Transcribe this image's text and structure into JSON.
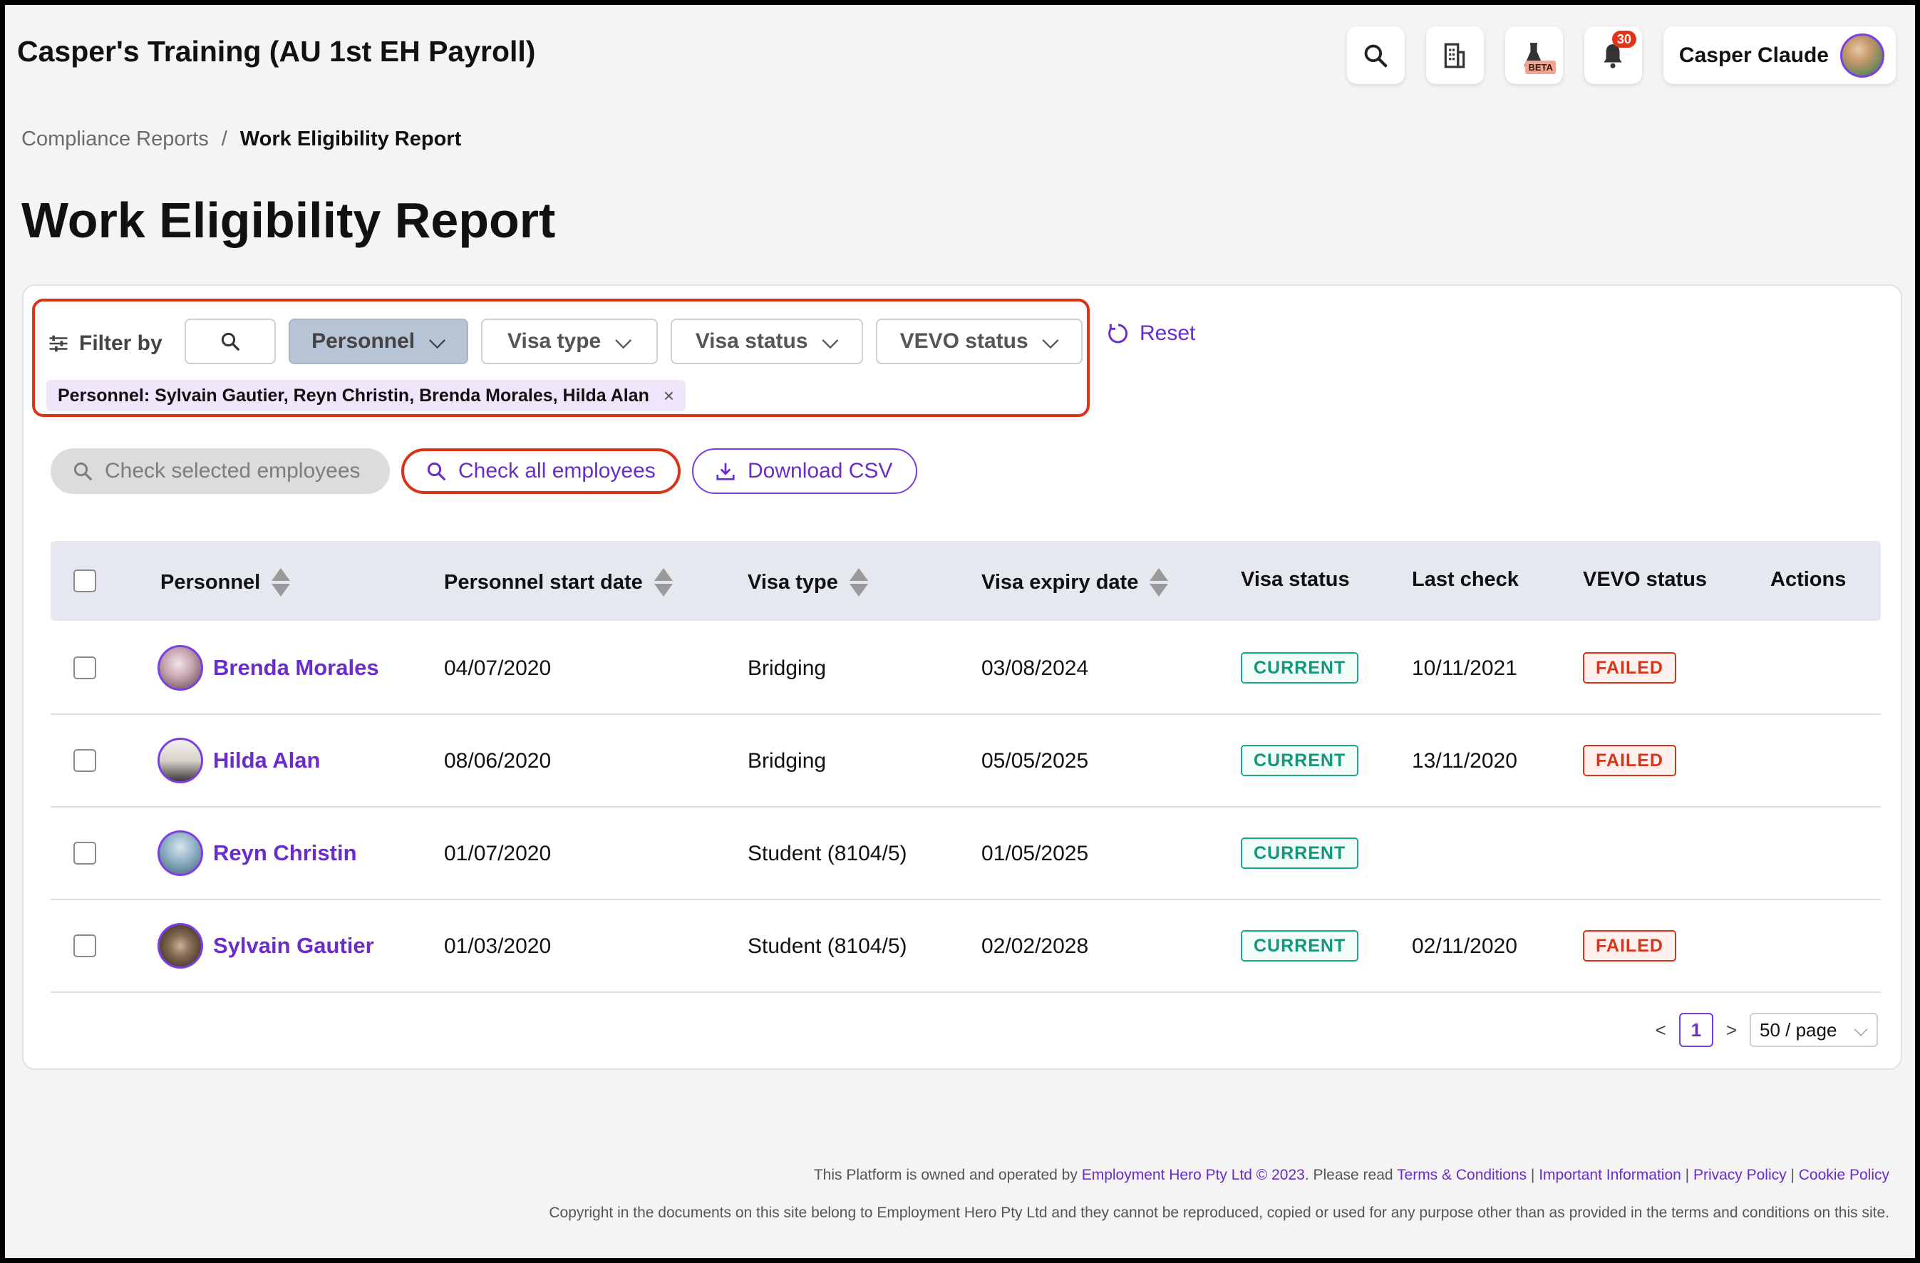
{
  "header": {
    "app_title": "Casper's Training (AU 1st EH Payroll)",
    "user_name": "Casper Claude",
    "notification_count": "30",
    "beta_label": "BETA"
  },
  "breadcrumb": {
    "parent": "Compliance Reports",
    "separator": "/",
    "current": "Work Eligibility Report"
  },
  "page_title": "Work Eligibility Report",
  "filters": {
    "label": "Filter by",
    "buttons": [
      "Personnel",
      "Visa type",
      "Visa status",
      "VEVO status"
    ],
    "active_tag": "Personnel: Sylvain Gautier, Reyn Christin, Brenda Morales, Hilda Alan",
    "reset_label": "Reset"
  },
  "actions": {
    "check_selected": "Check selected employees",
    "check_all": "Check all employees",
    "download_csv": "Download CSV"
  },
  "table": {
    "columns": [
      "Personnel",
      "Personnel start date",
      "Visa type",
      "Visa expiry date",
      "Visa status",
      "Last check",
      "VEVO status",
      "Actions"
    ],
    "rows": [
      {
        "name": "Brenda Morales",
        "start": "04/07/2020",
        "visa_type": "Bridging",
        "expiry": "03/08/2024",
        "visa_status": "CURRENT",
        "last_check": "10/11/2021",
        "vevo": "FAILED"
      },
      {
        "name": "Hilda Alan",
        "start": "08/06/2020",
        "visa_type": "Bridging",
        "expiry": "05/05/2025",
        "visa_status": "CURRENT",
        "last_check": "13/11/2020",
        "vevo": "FAILED"
      },
      {
        "name": "Reyn Christin",
        "start": "01/07/2020",
        "visa_type": "Student (8104/5)",
        "expiry": "01/05/2025",
        "visa_status": "CURRENT",
        "last_check": "",
        "vevo": ""
      },
      {
        "name": "Sylvain Gautier",
        "start": "01/03/2020",
        "visa_type": "Student (8104/5)",
        "expiry": "02/02/2028",
        "visa_status": "CURRENT",
        "last_check": "02/11/2020",
        "vevo": "FAILED"
      }
    ]
  },
  "pagination": {
    "prev": "<",
    "current_page": "1",
    "next": ">",
    "page_size": "50 / page"
  },
  "footer": {
    "line1_prefix": "This Platform is owned and operated by ",
    "company_link": "Employment Hero Pty Ltd © 2023",
    "line1_mid": ". Please read ",
    "terms": "Terms & Conditions",
    "important": "Important Information",
    "privacy": "Privacy Policy",
    "cookie": "Cookie Policy",
    "sep": " | ",
    "line2": "Copyright in the documents on this site belong to Employment Hero Pty Ltd and they cannot be reproduced, copied or used for any purpose other than as provided in the terms and conditions on this site."
  },
  "colors": {
    "accent": "#6a2ccb",
    "highlight_border": "#d9341a",
    "status_ok": "#13967a",
    "status_fail": "#d9341a"
  }
}
